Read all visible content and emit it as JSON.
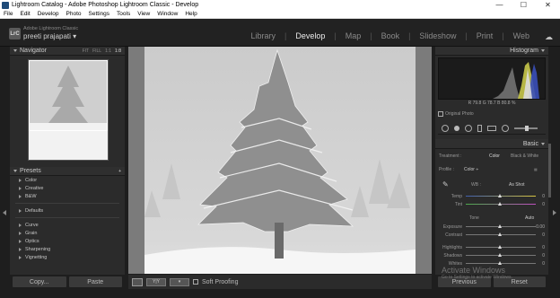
{
  "window": {
    "title": "Lightroom Catalog - Adobe Photoshop Lightroom Classic - Develop",
    "controls": [
      "—",
      "☐",
      "✕"
    ]
  },
  "menu": [
    "File",
    "Edit",
    "Develop",
    "Photo",
    "Settings",
    "Tools",
    "View",
    "Window",
    "Help"
  ],
  "identity": {
    "badge": "LrC",
    "brand": "Adobe Lightroom Classic",
    "user": "preeti prajapati",
    "user_menu": "▾",
    "modules": [
      "Library",
      "Develop",
      "Map",
      "Book",
      "Slideshow",
      "Print",
      "Web"
    ],
    "active_module": "Develop"
  },
  "navigator": {
    "title": "Navigator",
    "zoom": [
      "FIT",
      "FILL",
      "1:1",
      "1:8"
    ],
    "active_zoom": "1:8"
  },
  "presets": {
    "title": "Presets",
    "add": "+",
    "groups1": [
      "Color",
      "Creative",
      "B&W"
    ],
    "groups2": [
      "Defaults"
    ],
    "groups3": [
      "Curve",
      "Grain",
      "Optics",
      "Sharpening",
      "Vignetting"
    ]
  },
  "left_buttons": {
    "copy": "Copy...",
    "paste": "Paste"
  },
  "toolbar": {
    "soft_proofing": "Soft Proofing"
  },
  "histogram": {
    "title": "Histogram",
    "r_label": "R",
    "r": "79.8",
    "g_label": "G",
    "g": "78.7",
    "b_label": "B",
    "b": "80.8",
    "unit": "%",
    "original_photo": "Original Photo"
  },
  "basic": {
    "title": "Basic",
    "treatment_label": "Treatment :",
    "color": "Color",
    "bw": "Black & White",
    "profile_label": "Profile :",
    "profile": "Color",
    "wb_label": "WB :",
    "wb": "As Shot",
    "temp": "Temp",
    "tint": "Tint",
    "tone": "Tone",
    "auto": "Auto",
    "exposure": "Exposure",
    "exposure_val": "0.00",
    "contrast": "Contrast",
    "contrast_val": "0",
    "highlights": "Highlights",
    "highlights_val": "0",
    "shadows": "Shadows",
    "shadows_val": "0",
    "whites": "Whites",
    "whites_val": "0",
    "temp_val": "0",
    "tint_val": "0"
  },
  "right_buttons": {
    "previous": "Previous",
    "reset": "Reset"
  },
  "watermark": {
    "line1": "Activate Windows",
    "line2": "Go to Settings to activate Windows."
  }
}
